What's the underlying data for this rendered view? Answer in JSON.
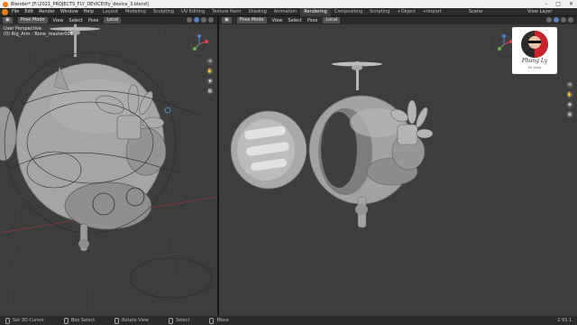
{
  "title_bar": {
    "title": "Blender* [F:\\2021_PROJECTS_FLY_DEVICE\\fly_device_3.blend]",
    "controls": [
      "minimize-icon",
      "maximize-icon",
      "close-icon"
    ]
  },
  "menu": [
    "File",
    "Edit",
    "Render",
    "Window",
    "Help"
  ],
  "workspace_tabs": [
    "Layout",
    "Modeling",
    "Sculpting",
    "UV Editing",
    "Texture Paint",
    "Shading",
    "Animation",
    "Rendering",
    "Compositing",
    "Scripting",
    "+Object",
    "+Import"
  ],
  "active_workspace": "Rendering",
  "scene": "Scene",
  "view_layer": "View Layer",
  "left_viewport": {
    "mode": "Pose Mode",
    "menus": [
      "View",
      "Select",
      "Pose"
    ],
    "orientation": "Local",
    "info_line1": "User Perspective",
    "info_line2": "(0) Rig_Arm : Bone_master003"
  },
  "right_viewport": {
    "mode": "Pose Mode",
    "menus": [
      "View",
      "Select",
      "Pose"
    ],
    "orientation": "Local"
  },
  "logo": {
    "name": "Phong Ly",
    "subtitle": "3D Artist"
  },
  "status_bar": {
    "items": [
      "Set 3D Cursor",
      "Box Select",
      "Rotate View",
      "Select",
      "Move"
    ],
    "version": "2.93.1"
  },
  "colors": {
    "viewport_bg": "#3d3d3d",
    "header_bg": "#2b2b2b",
    "accent": "#e87d0d",
    "selection": "#5680c2"
  }
}
